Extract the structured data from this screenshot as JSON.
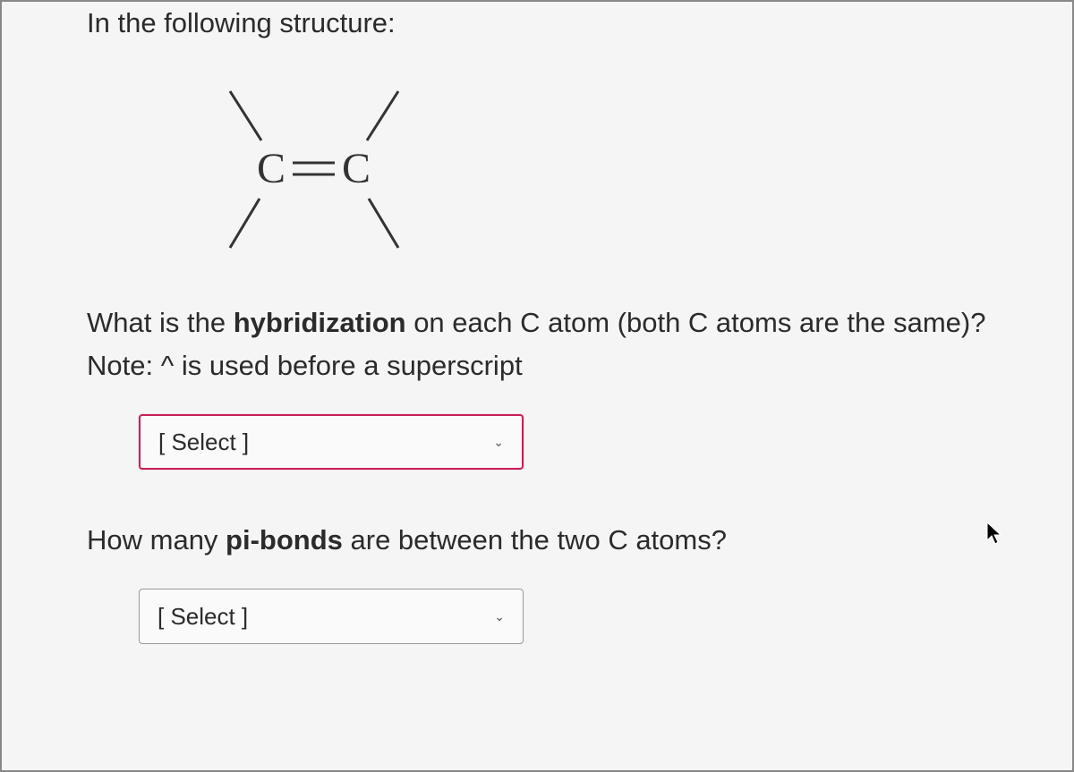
{
  "intro": "In the following structure:",
  "structure": {
    "left_atom": "C",
    "right_atom": "C",
    "bond_symbol": "="
  },
  "question1": {
    "prefix": "What is the ",
    "bold1": "hybridization",
    "mid": " on each C atom (both C atoms are the same)?  Note: ^ is used before a superscript"
  },
  "select1": {
    "placeholder": "[ Select ]"
  },
  "question2": {
    "prefix": "How many ",
    "bold1": "pi-bonds",
    "suffix": " are between the two C atoms?"
  },
  "select2": {
    "placeholder": "[ Select ]"
  }
}
